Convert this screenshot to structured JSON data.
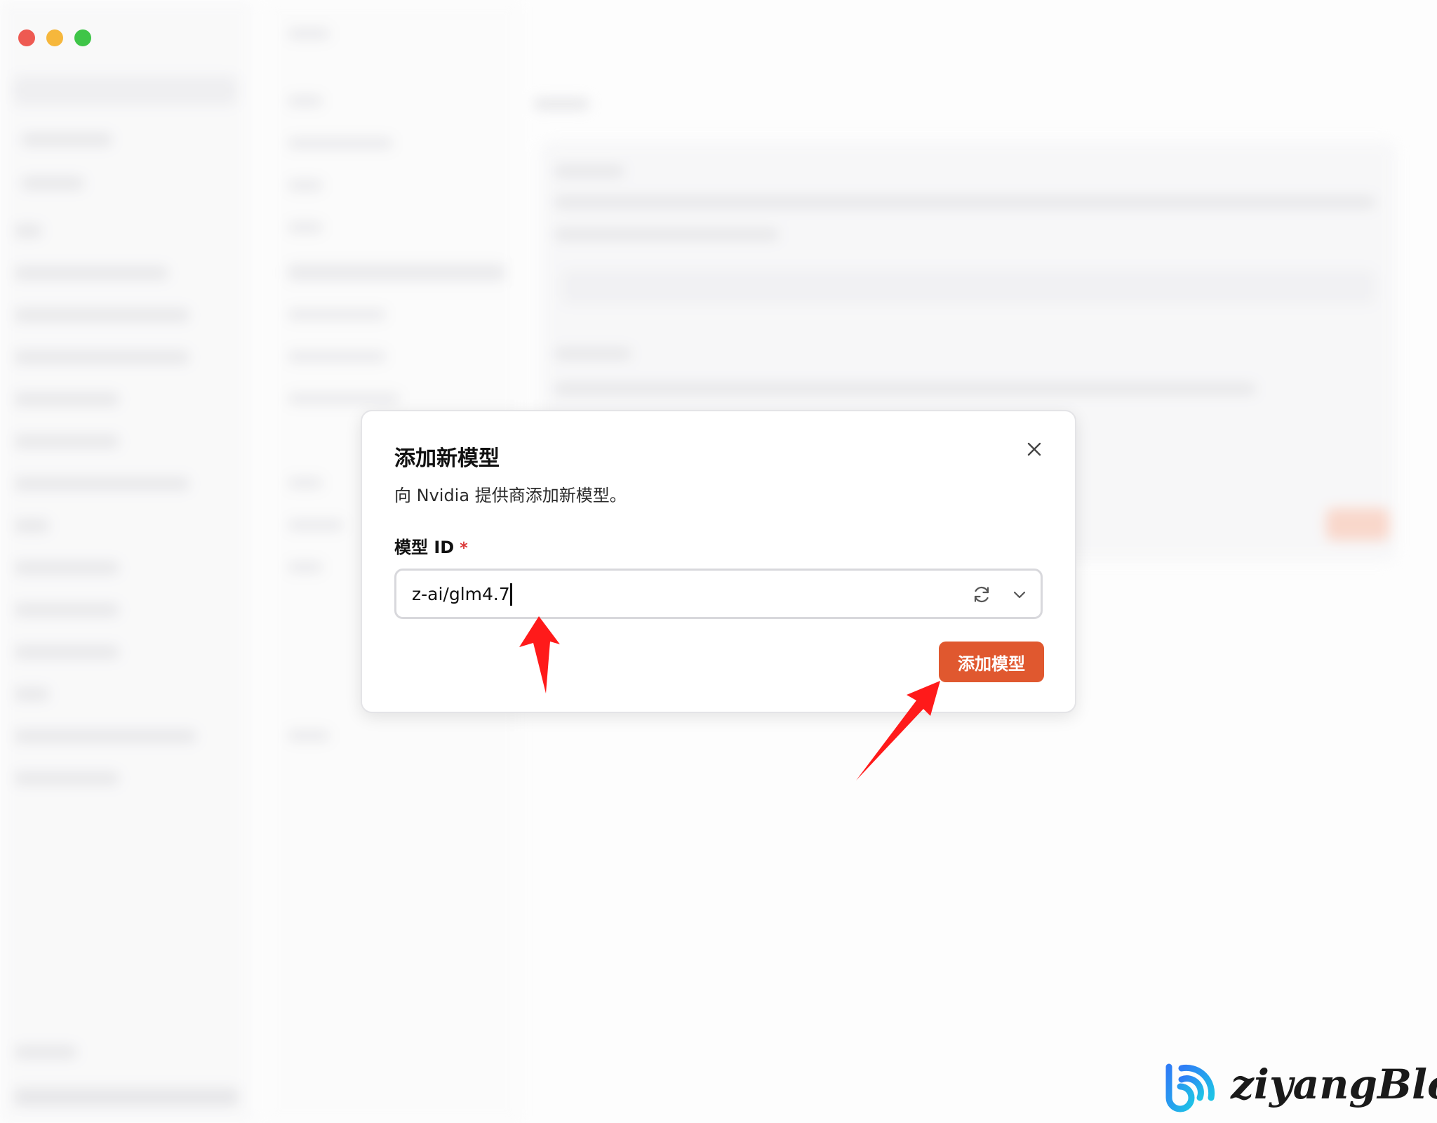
{
  "dialog": {
    "title": "添加新模型",
    "description": "向 Nvidia 提供商添加新模型。",
    "field_label": "模型 ID",
    "required_mark": "*",
    "model_id_value": "z-ai/glm4.7",
    "submit_label": "添加模型"
  },
  "icons": {
    "close": "close-icon",
    "refresh": "refresh-icon",
    "chevron": "chevron-down-icon"
  },
  "colors": {
    "accent": "#e0582f",
    "annotation_arrow": "#ff1a1a",
    "required": "#dc3b3b"
  },
  "watermark": {
    "text": "ziyangBlog"
  }
}
